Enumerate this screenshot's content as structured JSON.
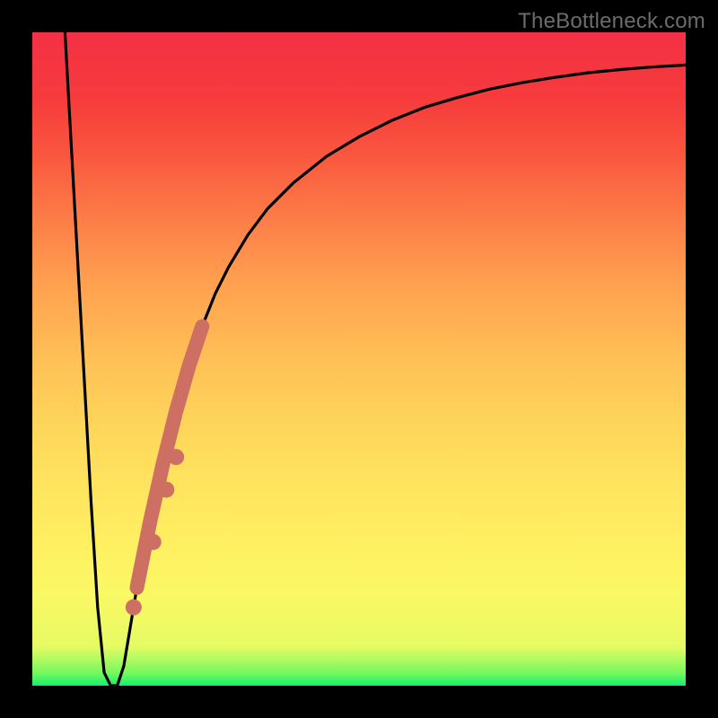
{
  "watermark_text": "TheBottleneck.com",
  "colors": {
    "frame": "#000000",
    "curve": "#000000",
    "segment": "#cd7063",
    "marker": "#cd7063"
  },
  "chart_data": {
    "type": "line",
    "title": "",
    "xlabel": "",
    "ylabel": "",
    "xlim": [
      0,
      100
    ],
    "ylim": [
      0,
      100
    ],
    "grid": false,
    "legend": false,
    "series": [
      {
        "name": "curve",
        "x": [
          5,
          6,
          7,
          8,
          9,
          10,
          11,
          12,
          13,
          14,
          15,
          16,
          18,
          20,
          22,
          24,
          26,
          28,
          30,
          33,
          36,
          40,
          45,
          50,
          55,
          60,
          65,
          70,
          75,
          80,
          85,
          90,
          95,
          100
        ],
        "y": [
          100,
          82,
          64,
          46,
          28,
          12,
          2,
          0,
          0,
          3,
          9,
          15,
          25,
          34,
          42,
          49,
          55,
          60,
          64,
          69,
          73,
          77,
          81,
          84,
          86.5,
          88.5,
          90,
          91.3,
          92.3,
          93.1,
          93.8,
          94.3,
          94.7,
          95
        ]
      }
    ],
    "highlight_segment": {
      "series": "curve",
      "x_start": 16,
      "x_end": 26,
      "stroke_width": 16
    },
    "markers": [
      {
        "x": 15.5,
        "y": 12
      },
      {
        "x": 18.5,
        "y": 22
      },
      {
        "x": 20.5,
        "y": 30
      },
      {
        "x": 22.0,
        "y": 35
      }
    ]
  }
}
